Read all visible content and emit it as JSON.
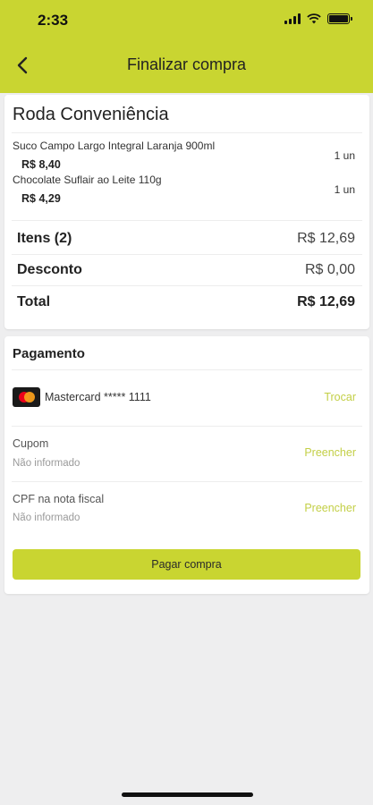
{
  "status_bar": {
    "time": "2:33"
  },
  "header": {
    "title": "Finalizar compra",
    "back_icon": "chevron-left-icon"
  },
  "order": {
    "store_name": "Roda Conveniência",
    "items": [
      {
        "name": "Suco Campo Largo Integral Laranja 900ml",
        "price": "R$ 8,40",
        "quantity": "1 un"
      },
      {
        "name": "Chocolate Suflair ao Leite 110g",
        "price": "R$ 4,29",
        "quantity": "1 un"
      }
    ],
    "summary": {
      "items_label": "Itens (2)",
      "items_value": "R$ 12,69",
      "discount_label": "Desconto",
      "discount_value": "R$ 0,00",
      "total_label": "Total",
      "total_value": "R$ 12,69"
    }
  },
  "payment": {
    "title": "Pagamento",
    "card_text": "Mastercard ***** 1111",
    "card_icon": "mastercard-icon",
    "change_label": "Trocar",
    "coupon_label": "Cupom",
    "coupon_value": "Não informado",
    "coupon_action": "Preencher",
    "cpf_label": "CPF na nota fiscal",
    "cpf_value": "Não informado",
    "cpf_action": "Preencher",
    "pay_button": "Pagar compra"
  },
  "colors": {
    "accent": "#c9d531",
    "link": "#c3cf46",
    "background": "#eeeeef"
  }
}
